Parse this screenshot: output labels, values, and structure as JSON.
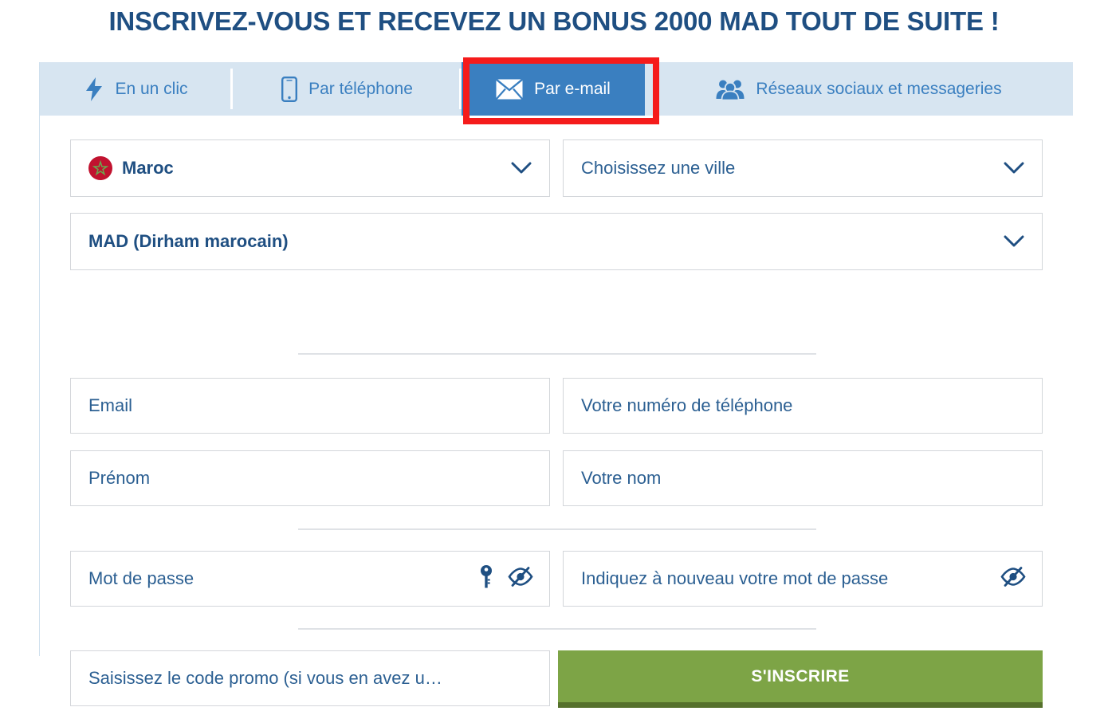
{
  "page": {
    "title": "INSCRIVEZ-VOUS ET RECEVEZ UN BONUS 2000 MAD TOUT DE SUITE !"
  },
  "colors": {
    "title_blue": "#1f4f82",
    "tab_bar_bg": "#d7e5f1",
    "tab_text": "#3a7fc0",
    "tab_active_bg": "#3a7fc0",
    "field_text": "#2b5f92",
    "submit_green": "#7da446",
    "submit_green_shadow": "#55702c",
    "annotation_red": "#f51b1b",
    "annotation_blue": "#3b39d1",
    "flag_red": "#c1122f",
    "flag_star_green": "#6aa84f"
  },
  "tabs": [
    {
      "id": "one-click",
      "label": "En un clic",
      "icon": "bolt-icon",
      "active": false
    },
    {
      "id": "phone",
      "label": "Par téléphone",
      "icon": "mobile-icon",
      "active": false
    },
    {
      "id": "email",
      "label": "Par e-mail",
      "icon": "envelope-icon",
      "active": true
    },
    {
      "id": "social",
      "label": "Réseaux sociaux et messageries",
      "icon": "people-icon",
      "active": false
    }
  ],
  "form": {
    "country": {
      "value": "Maroc",
      "icon": "morocco-flag-icon",
      "chevron": "chevron-down-icon"
    },
    "city": {
      "placeholder": "Choisissez une ville",
      "value": "Choisissez une ville",
      "chevron": "chevron-down-icon"
    },
    "currency": {
      "value": "MAD (Dirham marocain)",
      "chevron": "chevron-down-icon"
    },
    "email": {
      "placeholder": "Email",
      "value": "Email"
    },
    "phone": {
      "placeholder": "Votre numéro de téléphone",
      "value": "Votre numéro de téléphone"
    },
    "first_name": {
      "placeholder": "Prénom",
      "value": "Prénom"
    },
    "last_name": {
      "placeholder": "Votre nom",
      "value": "Votre nom"
    },
    "password": {
      "placeholder": "Mot de passe",
      "value": "Mot de passe",
      "key_icon": "key-icon",
      "toggle_icon": "eye-slash-icon"
    },
    "password_confirm": {
      "placeholder": "Indiquez à nouveau votre mot de passe",
      "value": "Indiquez à nouveau votre mot de passe",
      "toggle_icon": "eye-slash-icon"
    },
    "promo": {
      "placeholder": "Saisissez le code promo (si vous en avez u…",
      "value": "Saisissez le code promo (si vous en avez u…"
    },
    "submit": {
      "label": "S'INSCRIRE"
    }
  },
  "annotations": {
    "rect_target": "Par e-mail",
    "ellipse_target": "S'INSCRIRE"
  }
}
